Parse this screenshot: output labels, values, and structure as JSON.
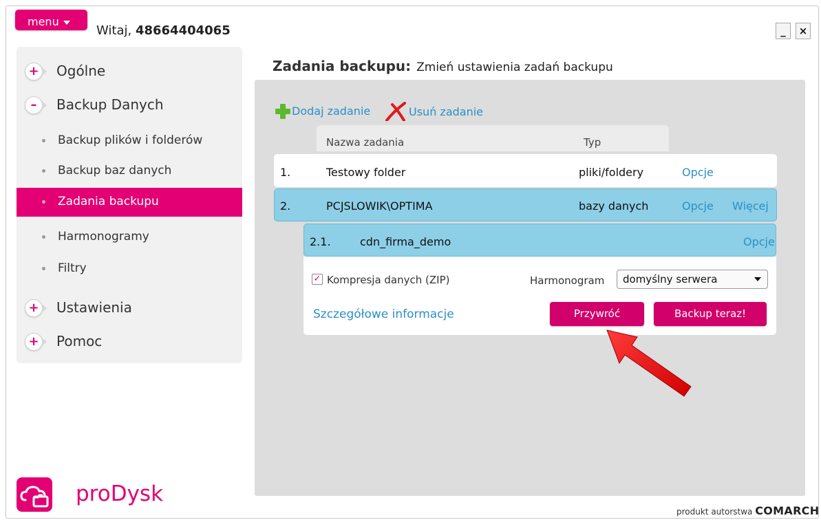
{
  "header": {
    "menu_label": "menu",
    "greeting": "Witaj,",
    "user_id": "48664404065",
    "minimize_label": "_",
    "close_label": "×"
  },
  "sidebar": {
    "groups": [
      {
        "label": "Ogólne",
        "symbol": "+"
      },
      {
        "label": "Backup Danych",
        "symbol": "–"
      },
      {
        "label": "Ustawienia",
        "symbol": "+"
      },
      {
        "label": "Pomoc",
        "symbol": "+"
      }
    ],
    "subitems": [
      {
        "label": "Backup plików i folderów"
      },
      {
        "label": "Backup baz danych"
      },
      {
        "label": "Zadania backupu"
      },
      {
        "label": "Harmonogramy"
      },
      {
        "label": "Filtry"
      }
    ]
  },
  "app": {
    "name": "proDysk"
  },
  "footer": {
    "prefix": "produkt autorstwa",
    "brand": "COMARCH"
  },
  "main": {
    "title": "Zadania backupu:",
    "description": "Zmień ustawienia zadań backupu",
    "actions": {
      "add": "Dodaj zadanie",
      "remove": "Usuń zadanie"
    },
    "columns": [
      "Nazwa zadania",
      "Typ"
    ],
    "rows": [
      {
        "num": "1.",
        "name": "Testowy folder",
        "type": "pliki/foldery",
        "options": "Opcje"
      },
      {
        "num": "2.",
        "name": "PCJSLOWIK\\OPTIMA",
        "type": "bazy danych",
        "options": "Opcje",
        "more": "Więcej"
      },
      {
        "num": "2.1.",
        "name": "cdn_firma_demo",
        "options": "Opcje"
      }
    ],
    "detail": {
      "checkbox_label": "Kompresja danych (ZIP)",
      "schedule_label": "Harmonogram",
      "schedule_value": "domyślny serwera",
      "info_link": "Szczegółowe informacje",
      "restore_button": "Przywróć",
      "backup_button": "Backup teraz!"
    }
  },
  "colors": {
    "accent": "#e20074",
    "link": "#2a8fc9",
    "row_highlight": "#8dcfe6",
    "arrow": "#e8121a"
  }
}
